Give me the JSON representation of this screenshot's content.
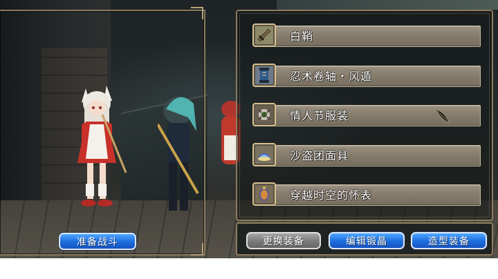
{
  "equipment": {
    "items": [
      {
        "label": "白鞘",
        "icon": "sword-icon"
      },
      {
        "label": "忍术卷轴・风遁",
        "icon": "scroll-icon"
      },
      {
        "label": "情人节服装",
        "icon": "costume-icon"
      },
      {
        "label": "沙盗团面具",
        "icon": "mask-icon"
      },
      {
        "label": "穿越时空的怀表",
        "icon": "pocket-watch-icon"
      }
    ]
  },
  "buttons": {
    "prepare_battle": "准备战斗",
    "change_equipment": "更换装备",
    "edit_forging_crystal": "编辑锻晶",
    "styling_equipment": "造型装备"
  },
  "colors": {
    "button_blue": "#1f6fe0",
    "button_gray": "#7d7d7d",
    "frame_gold": "#8d7c5c",
    "slot_bar": "#857b6b"
  }
}
